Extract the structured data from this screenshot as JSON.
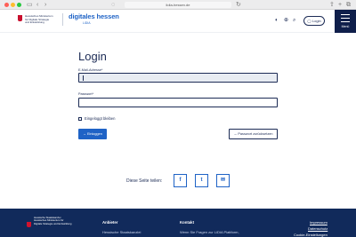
{
  "browser": {
    "url": "lidia-hessen.de",
    "traffic_lights": [
      "#fe5f57",
      "#febc2e",
      "#28c840"
    ]
  },
  "header": {
    "ministry_line1": "Hessisches Ministerium",
    "ministry_line2": "für Digitale Strategie",
    "ministry_line3": "und Entwicklung",
    "logo_text": "digitales hessen",
    "logo_sub": "LiDIA",
    "login_label": "Login",
    "menu_label": "Menü",
    "icons": [
      "accessibility-icon",
      "globe-icon",
      "search-icon"
    ]
  },
  "main": {
    "title": "Login",
    "email_label": "E-Mail-Adresse*",
    "password_label": "Passwort*",
    "remember_label": "Eingeloggt bleiben",
    "submit_label": "→ Einloggen",
    "reset_label": "→ Passwort zurücksetzen"
  },
  "share": {
    "label": "Diese Seite teilen:",
    "buttons": [
      "facebook-icon",
      "twitter-icon",
      "email-icon"
    ]
  },
  "footer": {
    "brand_line1": "Hessische Staatskanzlei",
    "brand_line2": "Hessisches Ministerium für",
    "brand_line3": "Digitale Strategie und Entwicklung",
    "col1_title": "Anbieter",
    "col1_text": "Hessische Staatskanzlei",
    "col2_title": "Kontakt",
    "col2_text": "Wenn Sie Fragen zur LiDIA Plattform,",
    "links": [
      "Impressum",
      "Datenschutz",
      "Cookie-Einstellungen"
    ]
  },
  "colors": {
    "navy": "#1c2b55",
    "blue": "#1f63c6",
    "footer_bg": "#112a5b",
    "crest_red": "#c8102e"
  }
}
